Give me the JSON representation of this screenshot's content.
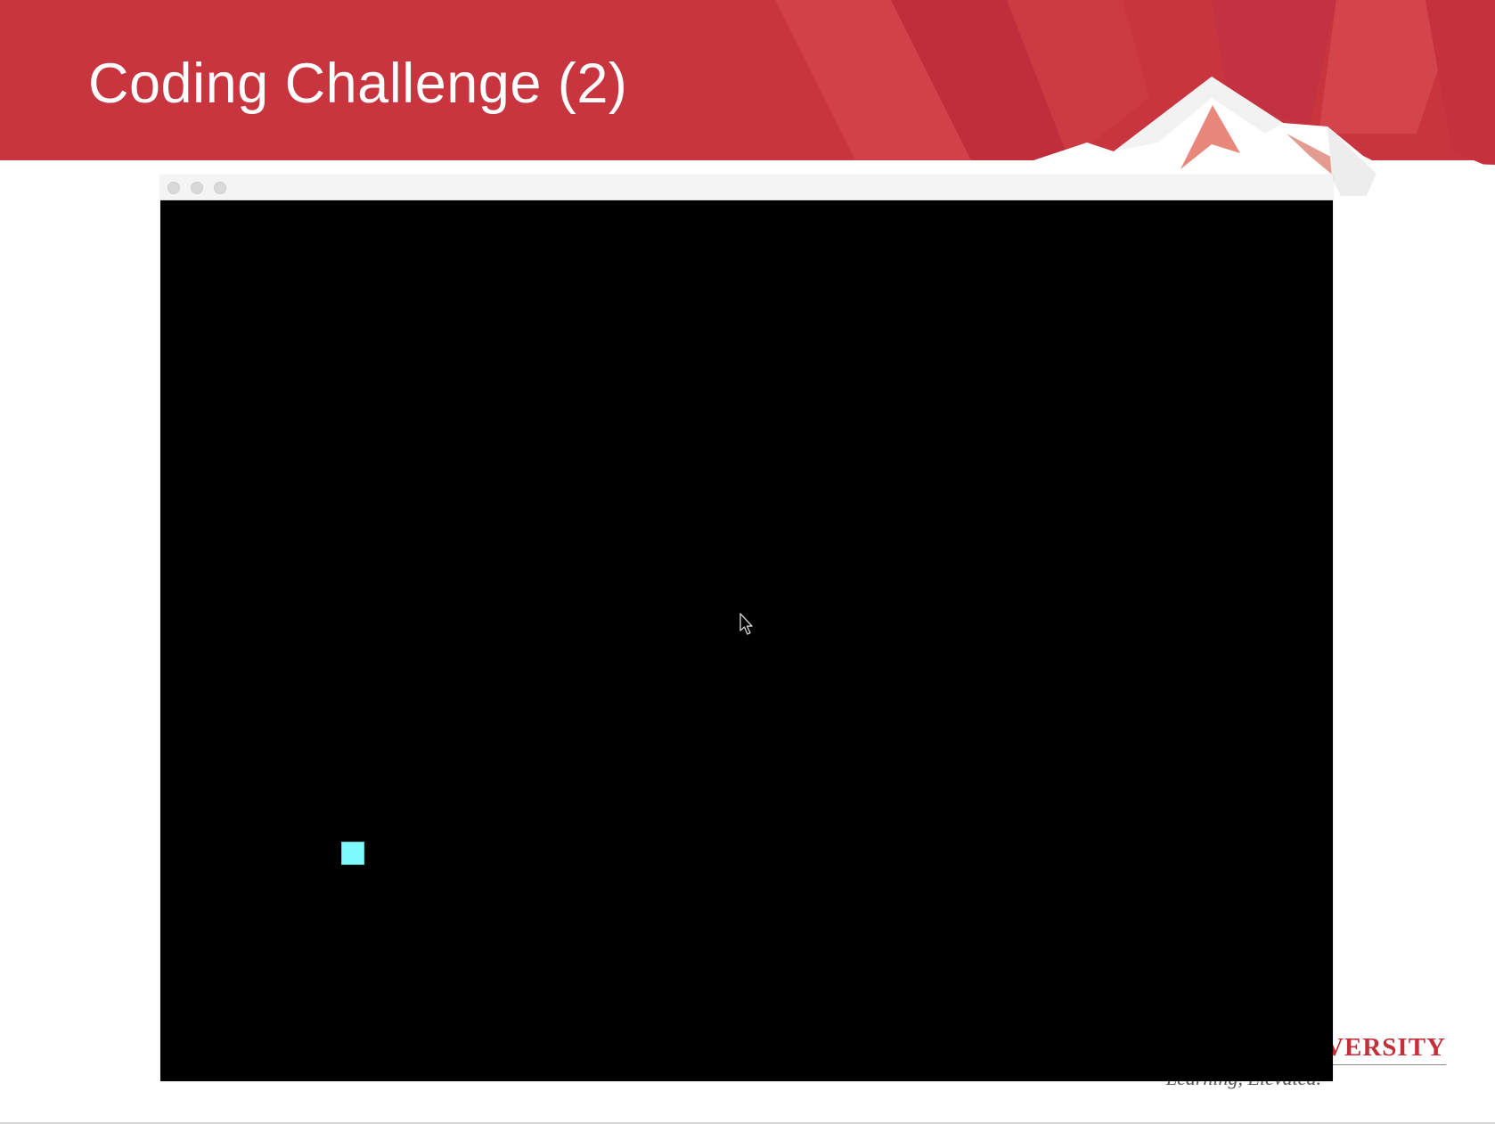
{
  "slide": {
    "title": "Coding Challenge (2)",
    "brand_name": "IVERSITY",
    "brand_tagline": "Learning, Elevated."
  },
  "window": {
    "traffic_lights": [
      "close",
      "minimize",
      "maximize"
    ]
  },
  "game": {
    "player_color": "#7ffbff",
    "player_border": "#4fd6dd",
    "background_color": "#000000"
  },
  "colors": {
    "header_red": "#c8353f",
    "brand_red": "#c3303c"
  }
}
